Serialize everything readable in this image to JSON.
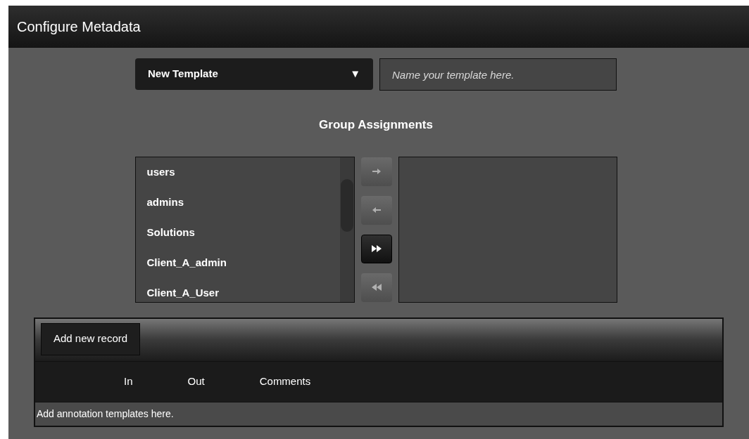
{
  "window": {
    "title": "Configure Metadata"
  },
  "template_select": {
    "value": "New Template",
    "caret": "▼"
  },
  "template_name": {
    "placeholder": "Name your template here."
  },
  "group_assignments": {
    "title": "Group Assignments",
    "available": [
      "users",
      "admins",
      "Solutions",
      "Client_A_admin",
      "Client_A_User"
    ],
    "move_buttons": [
      {
        "kind": "add",
        "disabled": true
      },
      {
        "kind": "remove",
        "disabled": true
      },
      {
        "kind": "add_all",
        "disabled": false
      },
      {
        "kind": "remove_all",
        "disabled": true
      }
    ]
  },
  "records": {
    "add_button": "Add new record",
    "columns": [
      "In",
      "Out",
      "Comments"
    ],
    "empty_message": "Add annotation templates here."
  }
}
